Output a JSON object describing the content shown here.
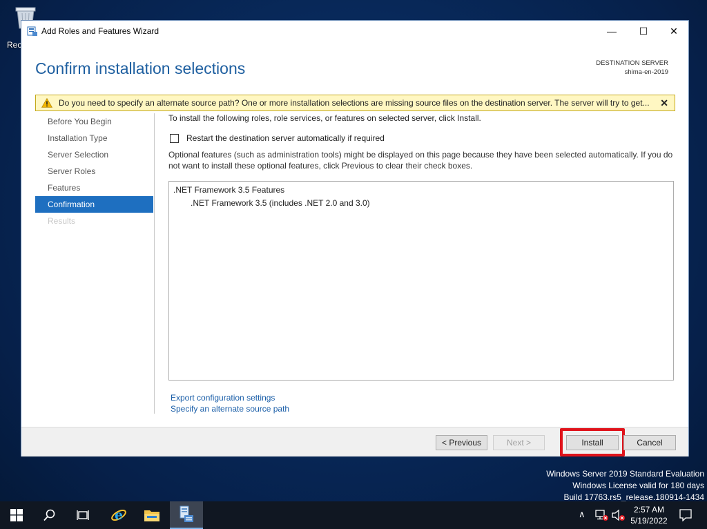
{
  "desktop": {
    "recycle_bin_label": "Rec"
  },
  "window": {
    "title": "Add Roles and Features Wizard",
    "minimize_glyph": "—",
    "maximize_glyph": "☐",
    "close_glyph": "✕"
  },
  "header": {
    "page_title": "Confirm installation selections",
    "destination_label": "DESTINATION SERVER",
    "destination_server": "shima-en-2019"
  },
  "warning": {
    "text": "Do you need to specify an alternate source path? One or more installation selections are missing source files on the destination server. The server will try to get...",
    "close_glyph": "✕",
    "icon": "warning-triangle-icon",
    "color": "#fff7c2"
  },
  "nav": {
    "items": [
      {
        "label": "Before You Begin",
        "state": "normal"
      },
      {
        "label": "Installation Type",
        "state": "normal"
      },
      {
        "label": "Server Selection",
        "state": "normal"
      },
      {
        "label": "Server Roles",
        "state": "normal"
      },
      {
        "label": "Features",
        "state": "normal"
      },
      {
        "label": "Confirmation",
        "state": "active"
      },
      {
        "label": "Results",
        "state": "disabled"
      }
    ],
    "active_color": "#1e6fc0"
  },
  "content": {
    "intro": "To install the following roles, role services, or features on selected server, click Install.",
    "restart_label": "Restart the destination server automatically if required",
    "restart_checked": false,
    "optional_note": "Optional features (such as administration tools) might be displayed on this page because they have been selected automatically. If you do not want to install these optional features, click Previous to clear their check boxes.",
    "features": [
      {
        "label": ".NET Framework 3.5 Features",
        "level": 1
      },
      {
        "label": ".NET Framework 3.5 (includes .NET 2.0 and 3.0)",
        "level": 2
      }
    ],
    "export_link": "Export configuration settings",
    "alt_source_link": "Specify an alternate source path"
  },
  "footer": {
    "previous_label": "< Previous",
    "next_label": "Next >",
    "install_label": "Install",
    "cancel_label": "Cancel",
    "highlight_color": "#e0131b"
  },
  "watermark": {
    "line1": "Windows Server 2019 Standard Evaluation",
    "line2": "Windows License valid for 180 days",
    "line3": "Build 17763.rs5_release.180914-1434"
  },
  "taskbar": {
    "icons": [
      "windows-start-icon",
      "search-icon",
      "task-view-icon",
      "internet-explorer-icon",
      "file-explorer-icon",
      "server-manager-icon"
    ],
    "tray_chevron": "∧",
    "time": "2:57 AM",
    "date": "5/19/2022"
  }
}
